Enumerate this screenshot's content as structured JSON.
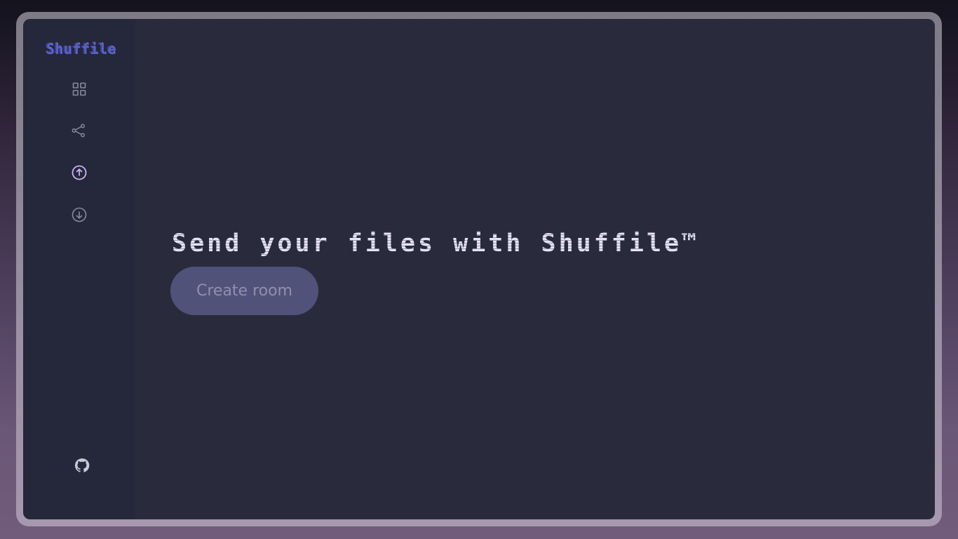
{
  "app": {
    "logo": "Shuffile"
  },
  "sidebar": {
    "items": [
      {
        "name": "dashboard",
        "icon": "grid-icon",
        "active": false
      },
      {
        "name": "share",
        "icon": "share-icon",
        "active": false
      },
      {
        "name": "upload",
        "icon": "upload-circle-icon",
        "active": true
      },
      {
        "name": "download",
        "icon": "download-circle-icon",
        "active": false
      }
    ],
    "footer_icon": "github-icon"
  },
  "main": {
    "headline": "Send your files with Shuffile™",
    "create_room_label": "Create room"
  },
  "colors": {
    "accent_active": "#c9b6f5",
    "icon_default": "#8a8a9c",
    "button_bg": "#505279",
    "button_text": "#8f90ae"
  }
}
